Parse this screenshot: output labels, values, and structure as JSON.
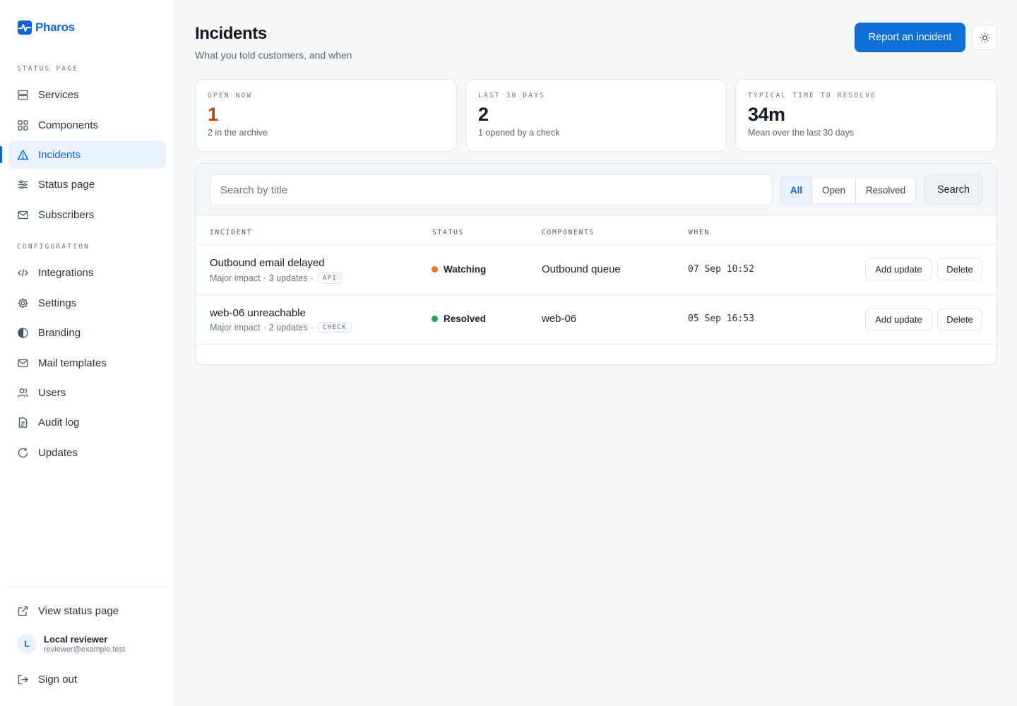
{
  "brand": {
    "name": "Pharos",
    "color": "#0f63d8"
  },
  "sidebar": {
    "section_status": "STATUS PAGE",
    "section_config": "CONFIGURATION",
    "items": [
      {
        "label": "Services",
        "icon": "server-icon"
      },
      {
        "label": "Components",
        "icon": "grid-icon"
      },
      {
        "label": "Incidents",
        "icon": "warning-icon",
        "active": true
      },
      {
        "label": "Status page",
        "icon": "sliders-icon"
      },
      {
        "label": "Subscribers",
        "icon": "mail-icon"
      },
      {
        "label": "Integrations",
        "icon": "code-icon"
      },
      {
        "label": "Settings",
        "icon": "gear-icon"
      },
      {
        "label": "Branding",
        "icon": "contrast-icon"
      },
      {
        "label": "Mail templates",
        "icon": "mail-icon"
      },
      {
        "label": "Users",
        "icon": "users-icon"
      },
      {
        "label": "Audit log",
        "icon": "document-icon"
      },
      {
        "label": "Updates",
        "icon": "refresh-icon"
      }
    ],
    "view_status_page": "View status page",
    "user": {
      "initial": "L",
      "name": "Local reviewer",
      "email": "reviewer@example.test"
    },
    "sign_out": "Sign out"
  },
  "header": {
    "title": "Incidents",
    "subtitle": "What you told customers, and when",
    "report_button": "Report an incident"
  },
  "stats": [
    {
      "label": "OPEN NOW",
      "value": "1",
      "note": "2 in the archive"
    },
    {
      "label": "LAST 30 DAYS",
      "value": "2",
      "note": "1 opened by a check"
    },
    {
      "label": "TYPICAL TIME TO RESOLVE",
      "value": "34m",
      "note": "Mean over the last 30 days"
    }
  ],
  "filters": {
    "search_placeholder": "Search by title",
    "segments": [
      "All",
      "Open",
      "Resolved"
    ],
    "active_segment": "All",
    "search_button": "Search"
  },
  "table": {
    "columns": [
      "INCIDENT",
      "STATUS",
      "COMPONENTS",
      "WHEN"
    ],
    "rows": [
      {
        "title": "Outbound email delayed",
        "impact": "Major impact",
        "updates": "3 updates",
        "source": "API",
        "status": "Watching",
        "status_color": "#f97316",
        "component": "Outbound queue",
        "when": "07 Sep 10:52",
        "add_update": "Add update",
        "delete": "Delete"
      },
      {
        "title": "web-06 unreachable",
        "impact": "Major impact",
        "updates": "2 updates",
        "source": "CHECK",
        "status": "Resolved",
        "status_color": "#22a55a",
        "component": "web-06",
        "when": "05 Sep 16:53",
        "add_update": "Add update",
        "delete": "Delete"
      }
    ]
  }
}
